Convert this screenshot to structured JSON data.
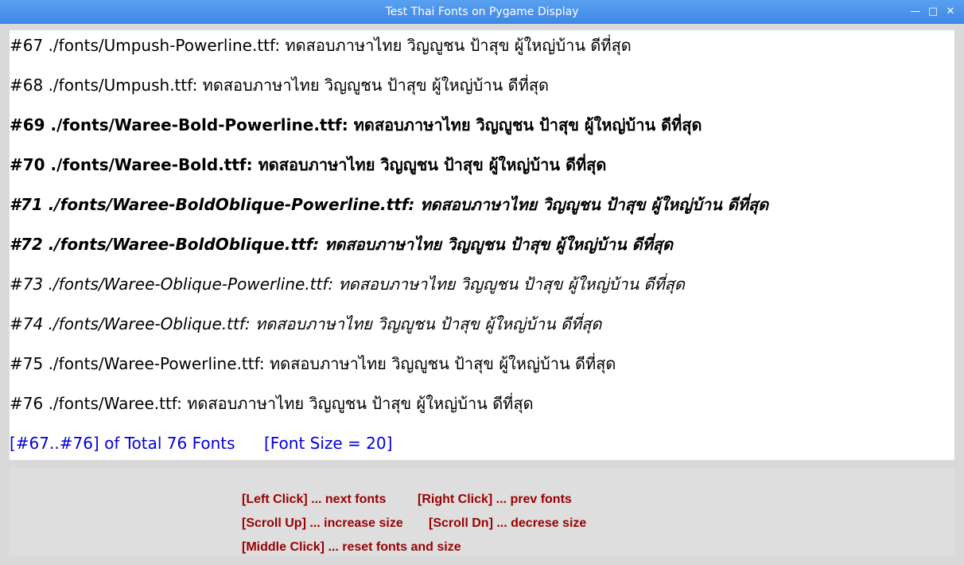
{
  "window": {
    "title": "Test Thai Fonts on Pygame Display",
    "minimize_glyph": "—",
    "maximize_glyph": "□",
    "close_glyph": "✕"
  },
  "font_lines": [
    {
      "text": "#67  ./fonts/Umpush-Powerline.ttf:  ทดสอบภาษาไทย  วิญญูชน  ป้าสุข  ผู้ใหญ่บ้าน  ดีที่สุด",
      "style": "regular"
    },
    {
      "text": "#68  ./fonts/Umpush.ttf:  ทดสอบภาษาไทย  วิญญูชน  ป้าสุข  ผู้ใหญ่บ้าน  ดีที่สุด",
      "style": "regular"
    },
    {
      "text": "#69 ./fonts/Waree-Bold-Powerline.ttf: ทดสอบภาษาไทย วิญญูชน ป้าสุข ผู้ใหญ่บ้าน ดีที่สุด",
      "style": "bold"
    },
    {
      "text": "#70 ./fonts/Waree-Bold.ttf: ทดสอบภาษาไทย วิญญูชน ป้าสุข ผู้ใหญ่บ้าน ดีที่สุด",
      "style": "bold"
    },
    {
      "text": "#71 ./fonts/Waree-BoldOblique-Powerline.ttf: ทดสอบภาษาไทย วิญญูชน ป้าสุข ผู้ใหญ่บ้าน ดีที่สุด",
      "style": "bolditalic"
    },
    {
      "text": "#72 ./fonts/Waree-BoldOblique.ttf: ทดสอบภาษาไทย วิญญูชน ป้าสุข ผู้ใหญ่บ้าน ดีที่สุด",
      "style": "bolditalic"
    },
    {
      "text": "#73 ./fonts/Waree-Oblique-Powerline.ttf: ทดสอบภาษาไทย วิญญูชน ป้าสุข ผู้ใหญ่บ้าน ดีที่สุด",
      "style": "italic"
    },
    {
      "text": "#74 ./fonts/Waree-Oblique.ttf: ทดสอบภาษาไทย วิญญูชน ป้าสุข ผู้ใหญ่บ้าน ดีที่สุด",
      "style": "italic"
    },
    {
      "text": "#75 ./fonts/Waree-Powerline.ttf: ทดสอบภาษาไทย วิญญูชน ป้าสุข ผู้ใหญ่บ้าน ดีที่สุด",
      "style": "regular"
    },
    {
      "text": "#76 ./fonts/Waree.ttf: ทดสอบภาษาไทย วิญญูชน ป้าสุข ผู้ใหญ่บ้าน ดีที่สุด",
      "style": "regular"
    }
  ],
  "status": {
    "range": "[#67..#76] of Total 76 Fonts",
    "font_size": "[Font Size = 20]",
    "color": "#0000dd"
  },
  "help": {
    "color": "#990000",
    "left_click": "[Left Click] ... next fonts",
    "right_click": "[Right Click] ... prev fonts",
    "scroll_up": "[Scroll Up] ... increase size",
    "scroll_dn": "[Scroll Dn] ... decrese size",
    "middle_click": "[Middle Click] ... reset fonts and size"
  }
}
